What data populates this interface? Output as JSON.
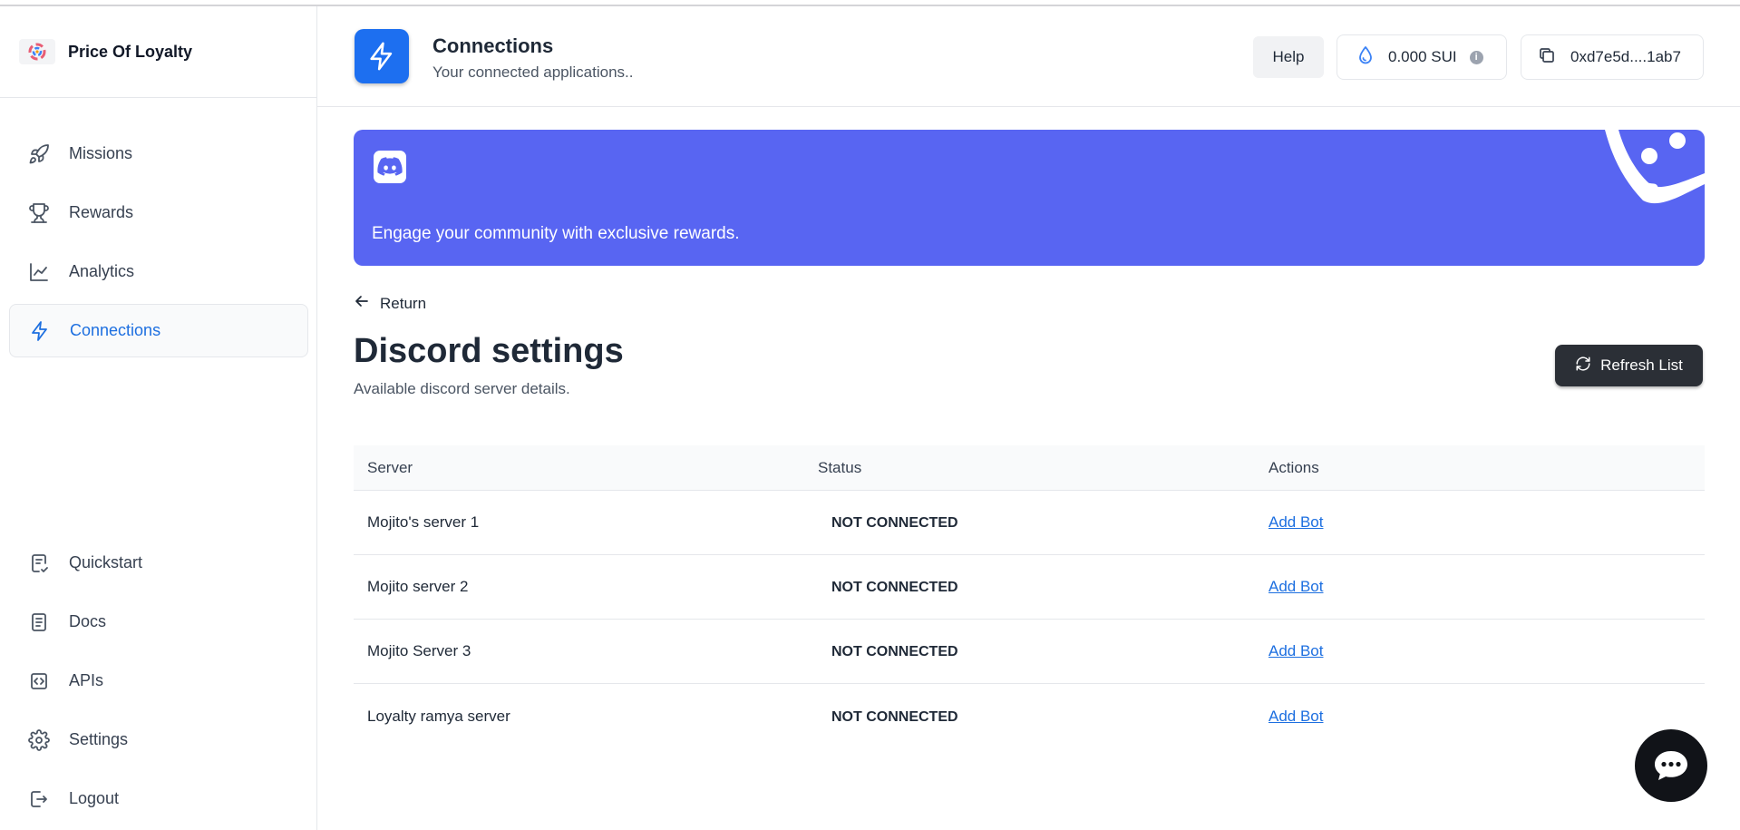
{
  "brand": {
    "name": "Price Of Loyalty"
  },
  "sidebar": {
    "main_items": [
      {
        "label": "Missions",
        "icon": "rocket-icon"
      },
      {
        "label": "Rewards",
        "icon": "trophy-icon"
      },
      {
        "label": "Analytics",
        "icon": "chart-line-icon"
      },
      {
        "label": "Connections",
        "icon": "lightning-icon",
        "active": true
      }
    ],
    "bottom_items": [
      {
        "label": "Quickstart",
        "icon": "quickstart-icon"
      },
      {
        "label": "Docs",
        "icon": "document-icon"
      },
      {
        "label": "APIs",
        "icon": "code-icon"
      },
      {
        "label": "Settings",
        "icon": "gear-icon"
      },
      {
        "label": "Logout",
        "icon": "logout-icon"
      }
    ]
  },
  "header": {
    "title": "Connections",
    "subtitle": "Your connected applications..",
    "help_label": "Help",
    "balance": "0.000 SUI",
    "wallet_address": "0xd7e5d....1ab7"
  },
  "banner": {
    "text": "Engage your community with exclusive rewards.",
    "color": "#5865f2"
  },
  "content": {
    "return_label": "Return",
    "title": "Discord settings",
    "subtitle": "Available discord server details.",
    "refresh_label": "Refresh List"
  },
  "table": {
    "headers": [
      "Server",
      "Status",
      "Actions"
    ],
    "rows": [
      {
        "server": "Mojito's server 1",
        "status": "NOT CONNECTED",
        "action": "Add Bot"
      },
      {
        "server": "Mojito server 2",
        "status": "NOT CONNECTED",
        "action": "Add Bot"
      },
      {
        "server": "Mojito Server 3",
        "status": "NOT CONNECTED",
        "action": "Add Bot"
      },
      {
        "server": "Loyalty ramya server",
        "status": "NOT CONNECTED",
        "action": "Add Bot"
      }
    ]
  },
  "colors": {
    "accent": "#1d6ff0",
    "link": "#1d6fe0",
    "dark_button": "#2b2f36"
  }
}
